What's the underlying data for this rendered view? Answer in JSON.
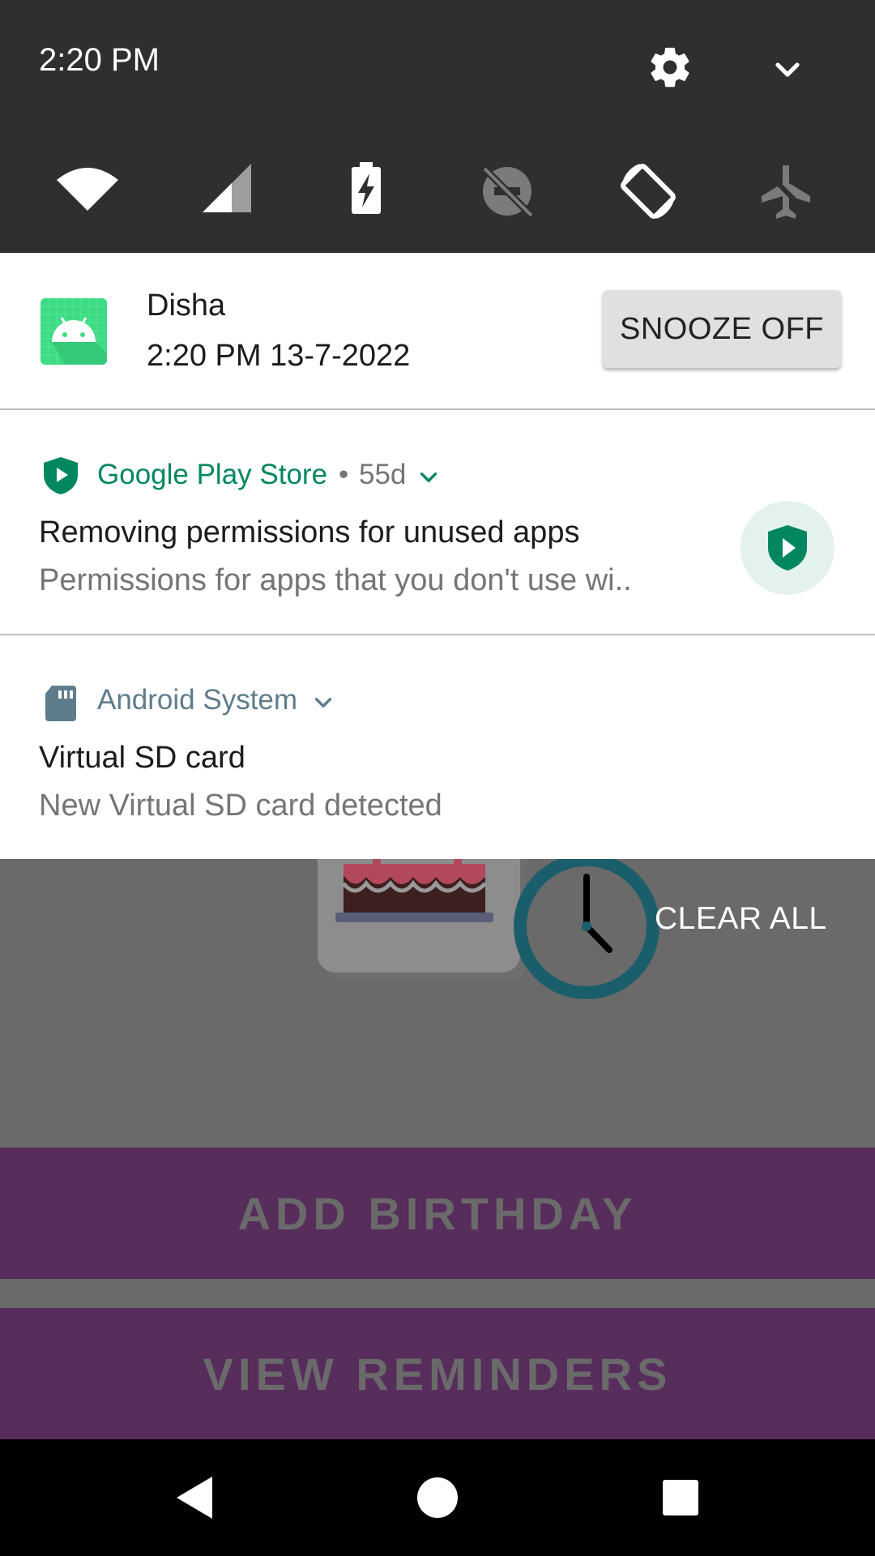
{
  "quick_settings": {
    "time": "2:20 PM",
    "icons": [
      "gear-icon",
      "chevron-down-icon",
      "wifi-icon",
      "cell-signal-icon",
      "battery-charging-icon",
      "do-not-disturb-off-icon",
      "auto-rotate-icon",
      "airplane-mode-icon"
    ]
  },
  "notifications": [
    {
      "app": "Disha",
      "text": "2:20 PM 13-7-2022",
      "action": "SNOOZE OFF"
    },
    {
      "app": "Google Play Store",
      "separator": "•",
      "age": "55d",
      "title": "Removing permissions for unused apps",
      "text": "Permissions for apps that you don't use wi..",
      "accent": "#01875f"
    },
    {
      "app": "Android System",
      "title": "Virtual SD card",
      "text": "New Virtual SD card detected",
      "accent": "#5f7c8b"
    }
  ],
  "background_app": {
    "clear_all": "CLEAR ALL",
    "add_birthday": "ADD BIRTHDAY",
    "view_reminders": "VIEW REMINDERS",
    "button_color": "#572d5c"
  },
  "navigation": [
    "back-icon",
    "home-icon",
    "recents-icon"
  ]
}
